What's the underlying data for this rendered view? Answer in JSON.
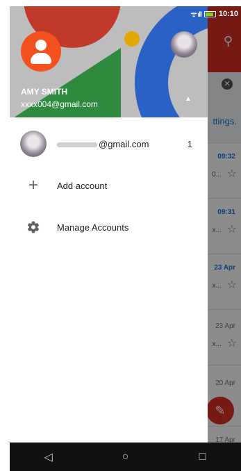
{
  "status_bar": {
    "time": "10:10"
  },
  "background_app": {
    "banner_link": "ttings.",
    "rows": [
      {
        "time": "09:32",
        "snippet": "0...",
        "unread": true
      },
      {
        "time": "09:31",
        "snippet": "x...",
        "unread": true
      },
      {
        "time": "23 Apr",
        "snippet": "x...",
        "unread": true
      },
      {
        "time": "23 Apr",
        "snippet": "x...",
        "unread": false
      },
      {
        "time": "20 Apr",
        "snippet": "",
        "unread": false
      },
      {
        "time": "17 Apr",
        "snippet": "",
        "unread": false
      }
    ]
  },
  "drawer": {
    "account_name": "AMY SMITH",
    "account_email": "xxxx004@gmail.com",
    "items": [
      {
        "label": "@gmail.com",
        "count": "1",
        "icon": "account-avatar"
      },
      {
        "label": "Add account",
        "icon": "plus-icon"
      },
      {
        "label": "Manage Accounts",
        "icon": "gear-icon"
      }
    ]
  },
  "colors": {
    "gmail_red": "#d93025",
    "avatar_orange": "#f4511e",
    "header_blue": "#2962c4",
    "header_green": "#2e8b3e"
  }
}
